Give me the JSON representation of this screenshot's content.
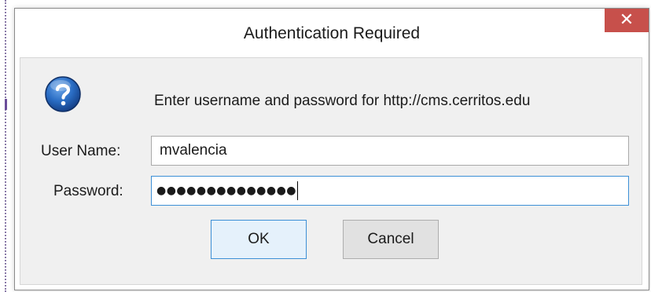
{
  "window": {
    "title": "Authentication Required",
    "close_glyph": "✕"
  },
  "dialog": {
    "icon": "question-icon",
    "message": "Enter username and password for http://cms.cerritos.edu",
    "username_label": "User Name:",
    "username_value": "mvalencia",
    "password_label": "Password:",
    "password_masked": "●●●●●●●●●●●●●●"
  },
  "buttons": {
    "ok_label": "OK",
    "cancel_label": "Cancel"
  },
  "colors": {
    "close_button": "#c7504b",
    "focus_border": "#3c8fd6",
    "client_background": "#f0f0f0",
    "question_icon": "#1f5fb3"
  }
}
